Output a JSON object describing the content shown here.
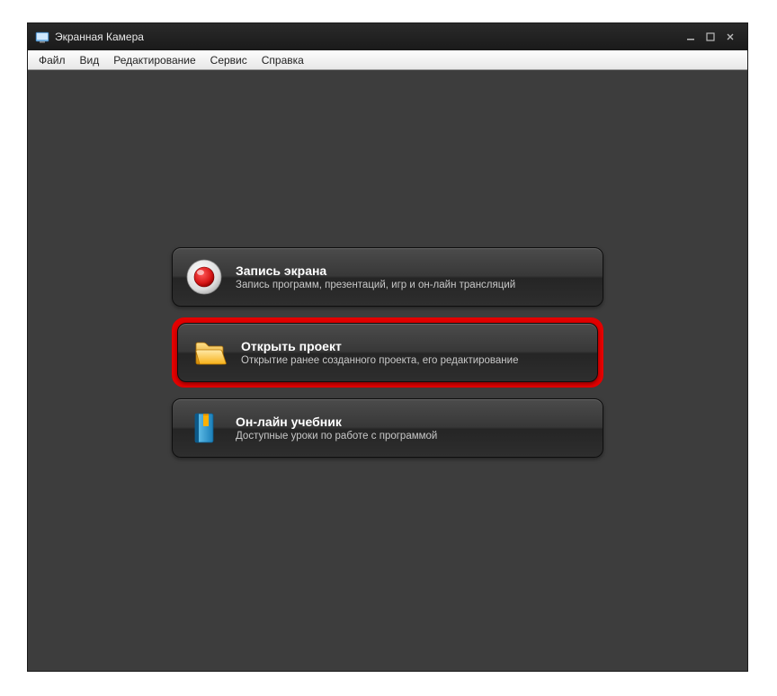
{
  "window": {
    "title": "Экранная Камера"
  },
  "menubar": [
    "Файл",
    "Вид",
    "Редактирование",
    "Сервис",
    "Справка"
  ],
  "cards": [
    {
      "title": "Запись экрана",
      "subtitle": "Запись программ, презентаций, игр и он-лайн трансляций",
      "icon": "record-icon",
      "highlighted": false
    },
    {
      "title": "Открыть проект",
      "subtitle": "Открытие ранее созданного проекта, его редактирование",
      "icon": "folder-icon",
      "highlighted": true
    },
    {
      "title": "Он-лайн учебник",
      "subtitle": "Доступные уроки по работе с программой",
      "icon": "book-icon",
      "highlighted": false
    }
  ],
  "colors": {
    "highlight": "#e30000",
    "record": "#d81818",
    "folder": "#f7b21a",
    "book": "#2aa6e0"
  }
}
